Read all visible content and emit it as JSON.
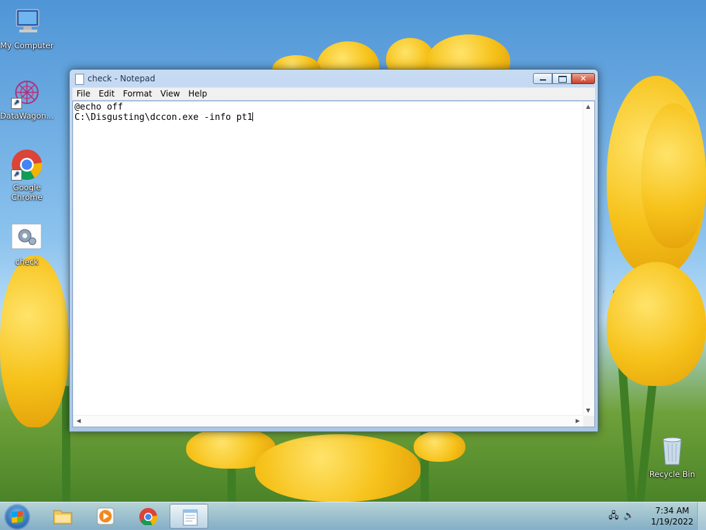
{
  "desktop": {
    "icons": [
      {
        "label": "My Computer"
      },
      {
        "label": "DataWagon..."
      },
      {
        "label": "Google Chrome"
      },
      {
        "label": "check"
      },
      {
        "label": "Recycle Bin"
      }
    ]
  },
  "window": {
    "title": "check - Notepad",
    "menu": [
      "File",
      "Edit",
      "Format",
      "View",
      "Help"
    ],
    "content_lines": [
      "@echo off",
      "C:\\Disgusting\\dccon.exe -info pt1"
    ]
  },
  "taskbar": {
    "time": "7:34 AM",
    "date": "1/19/2022"
  },
  "icons": [
    "computer-icon",
    "datawagon-icon",
    "chrome-icon",
    "settings-icon",
    "recycle-bin-icon",
    "folder-icon",
    "media-player-icon",
    "notepad-icon",
    "network-icon",
    "volume-icon",
    "windows-start-icon"
  ]
}
